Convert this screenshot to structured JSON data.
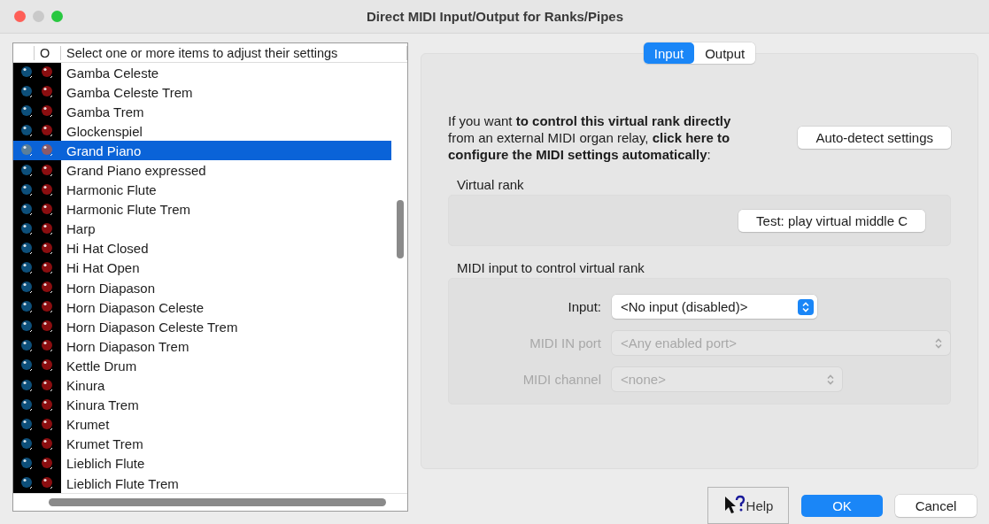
{
  "window": {
    "title": "Direct MIDI Input/Output for Ranks/Pipes"
  },
  "list": {
    "column_2": "O",
    "column_3": "Select one or more items to adjust their settings",
    "rows": [
      {
        "name": "Gamba Celeste",
        "selected": false
      },
      {
        "name": "Gamba Celeste Trem",
        "selected": false
      },
      {
        "name": "Gamba Trem",
        "selected": false
      },
      {
        "name": "Glockenspiel",
        "selected": false
      },
      {
        "name": "Grand Piano",
        "selected": true
      },
      {
        "name": "Grand Piano expressed",
        "selected": false
      },
      {
        "name": "Harmonic Flute",
        "selected": false
      },
      {
        "name": "Harmonic Flute Trem",
        "selected": false
      },
      {
        "name": "Harp",
        "selected": false
      },
      {
        "name": "Hi Hat Closed",
        "selected": false
      },
      {
        "name": "Hi Hat Open",
        "selected": false
      },
      {
        "name": "Horn Diapason",
        "selected": false
      },
      {
        "name": "Horn Diapason Celeste",
        "selected": false
      },
      {
        "name": "Horn Diapason Celeste Trem",
        "selected": false
      },
      {
        "name": "Horn Diapason Trem",
        "selected": false
      },
      {
        "name": "Kettle Drum",
        "selected": false
      },
      {
        "name": "Kinura",
        "selected": false
      },
      {
        "name": "Kinura Trem",
        "selected": false
      },
      {
        "name": "Krumet",
        "selected": false
      },
      {
        "name": "Krumet Trem",
        "selected": false
      },
      {
        "name": "Lieblich Flute",
        "selected": false
      },
      {
        "name": "Lieblich Flute Trem",
        "selected": false
      }
    ]
  },
  "tabs": [
    {
      "label": "Input",
      "selected": true
    },
    {
      "label": "Output",
      "selected": false
    }
  ],
  "intro": "If you want **to control this virtual rank directly** from an external MIDI organ relay, **click here to configure the MIDI settings automatically**:",
  "auto_detect_button": "Auto-detect settings",
  "virtual_rank": {
    "title": "Virtual rank",
    "test_button": "Test: play virtual middle C"
  },
  "midi_input": {
    "title": "MIDI input to control virtual rank",
    "fields": [
      {
        "label": "Input:",
        "value": "<No input (disabled)>",
        "disabled": false
      },
      {
        "label": "MIDI IN port",
        "value": "<Any enabled port>",
        "disabled": true
      },
      {
        "label": "MIDI channel",
        "value": "<none>",
        "disabled": true
      }
    ]
  },
  "buttons": {
    "help": "Help",
    "ok": "OK",
    "cancel": "Cancel"
  }
}
